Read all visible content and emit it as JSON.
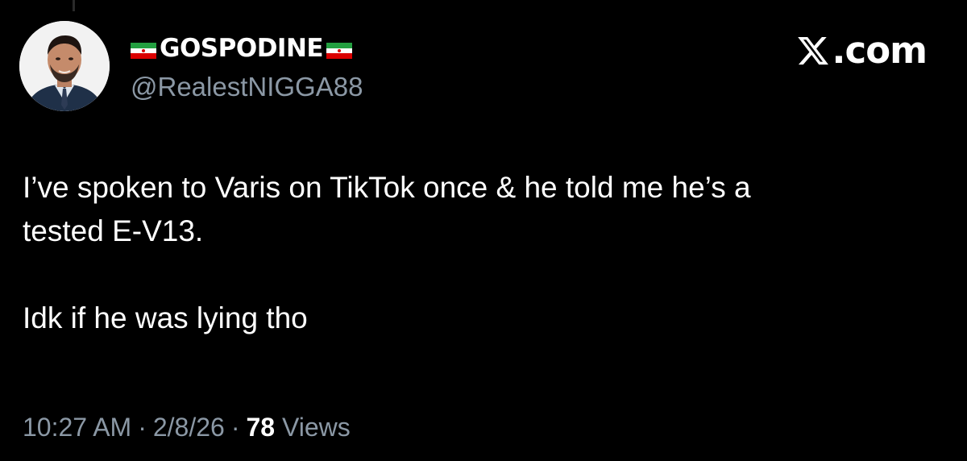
{
  "tweet": {
    "display_name": "GOSPODINE",
    "handle": "@RealestNIGGA88",
    "brand": ".com",
    "text_lines": [
      "I’ve spoken to Varis on TikTok once & he told me he’s a",
      "tested E-V13."
    ],
    "text_second_paragraph": "Idk if he was lying tho",
    "time": "10:27 AM",
    "date": "2/8/26",
    "separator": "·",
    "views_count": "78",
    "views_label": "Views"
  },
  "icons": {
    "flag": "iran-flag-icon",
    "brand_logo": "x-logo-icon",
    "avatar": "user-avatar"
  },
  "colors": {
    "background": "#000000",
    "text": "#ffffff",
    "secondary": "#8b98a5",
    "flag_green": "#239f40",
    "flag_red": "#da0000"
  }
}
